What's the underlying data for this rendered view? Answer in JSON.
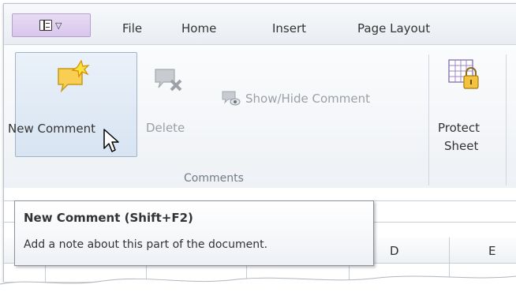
{
  "tabs": [
    "File",
    "Home",
    "Insert",
    "Page Layout"
  ],
  "ribbon": {
    "new_comment": "New Comment",
    "delete": "Delete",
    "show_hide": "Show/Hide Comment",
    "group_label": "Comments",
    "protect_line1": "Protect",
    "protect_line2": "Sheet"
  },
  "columns": [
    "D",
    "E"
  ],
  "tooltip": {
    "title": "New Comment (Shift+F2)",
    "description": "Add a note about this part of the document."
  },
  "icons": [
    "app-menu-icon",
    "new-comment-icon",
    "delete-comment-icon",
    "show-hide-comment-icon",
    "protect-sheet-icon",
    "mouse-cursor-icon"
  ],
  "colors": {
    "accent_purple": "#d8c6ec",
    "hover_blue": "#d8e4f2"
  }
}
